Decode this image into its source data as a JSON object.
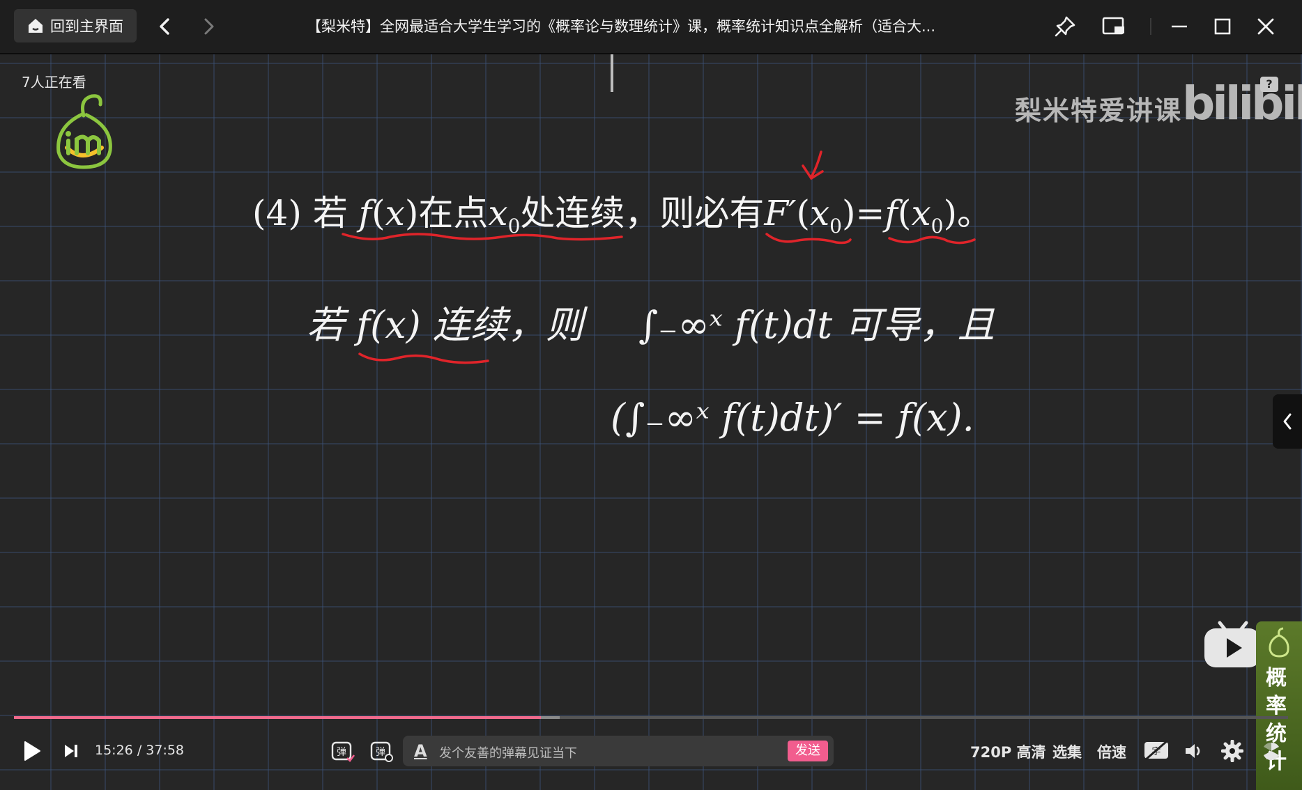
{
  "titlebar": {
    "home_label": "回到主界面",
    "title": "【梨米特】全网最适合大学生学习的《概率论与数理统计》课，概率统计知识点全解析（适合大..."
  },
  "video": {
    "viewers": "7人正在看",
    "watermark": "梨米特爱讲课",
    "platform_logo": "bilibili",
    "help_badge": "?",
    "statement": {
      "label": "(4) 若 ",
      "f1": "f",
      "p1": "(",
      "x1": "x",
      "p2": ")",
      "t1": "在点",
      "x0a": "x",
      "sub0": "0",
      "t2": "处连续，则必有",
      "F": "F′",
      "p3": "(",
      "x0b": "x",
      "sub1": "0",
      "p4": ")=",
      "f2": "f",
      "p5": "(",
      "x0c": "x",
      "sub2": "0",
      "p6": ")。"
    },
    "handwritten": {
      "line1a": "若 f(x) 连续，则",
      "line1b": "∫₋∞ˣ f(t)dt 可导，且",
      "line2": "(∫₋∞ˣ f(t)dt)′ = f(x)."
    },
    "side_strip_text": "概率统计"
  },
  "controls": {
    "current_time": "15:26",
    "separator": "/",
    "duration": "37:58",
    "progress": 0.4138,
    "danmaku_placeholder": "发个友善的弹幕见证当下",
    "send_label": "发送",
    "quality": "720P 高清",
    "episodes": "选集",
    "speed": "倍速"
  },
  "colors": {
    "accent": "#f25d8e",
    "annotation_red": "#e0242a"
  }
}
